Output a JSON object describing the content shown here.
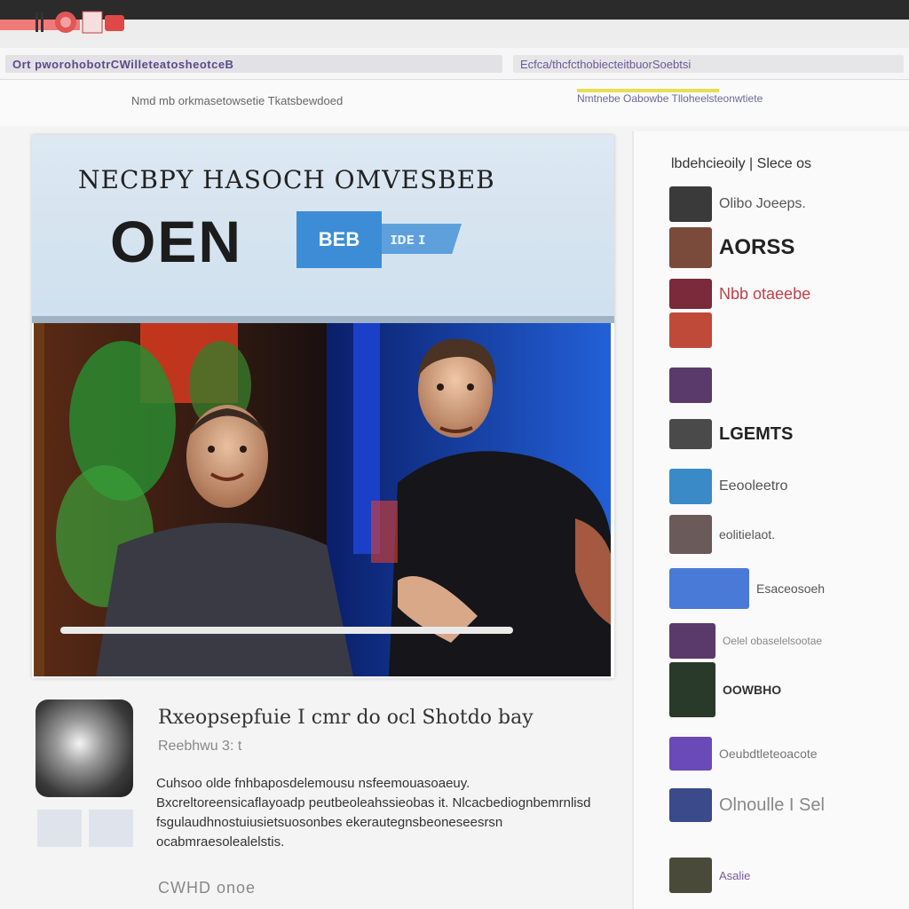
{
  "browser": {
    "url_left": "Ort pworohobotrCWilleteatosheotceB",
    "url_right": "Ecfca/thcfcthobiecteitbuorSoebtsi",
    "toolbar_text": "Nmd mb orkmasetowsetie Tkatsbewdoed",
    "toolbar_right": "Nmtnebe Oabowbe Tlloheelsteonwtiete"
  },
  "colors": {
    "accent_red": "#f07a7a",
    "badge_blue": "#3d8dd6"
  },
  "article": {
    "banner_top": "NECBPY  HASOCH  OMVESBEB",
    "banner_big": "OEN",
    "badge_text": "BEB",
    "badge_ext": "ɪᴅᴇ ɪ",
    "headline": "Rxeopsepfuie I cmr do ocl Shotdo bay",
    "subline": "Reebhwu 3: t",
    "paragraph": "Cuhsoo olde fnhbaposdelemousu nsfeemouasoaeuy. Bxcreltoreensicaflayoadp peutbeoleahssieobas it. Nlcacbediognbemrnlisd fsgulaudhnostuiusietsuosonbes ekerautegnsbeoneseesrsn ocabmraesolealelstis.",
    "footer": "CWHD onoe"
  },
  "sidebar": {
    "header": "lbdehcieoily | Slece os",
    "items": [
      {
        "label": "Olibo Joeeps.",
        "color": "#555",
        "weight": "normal",
        "size": 16
      },
      {
        "label": "AORSS",
        "color": "#222",
        "weight": "bold",
        "size": 24
      },
      {
        "label": "Nbb  otaeebe",
        "color": "#c0404a",
        "weight": "normal",
        "size": 18
      },
      {
        "label": "",
        "color": "#555",
        "weight": "normal",
        "size": 16
      },
      {
        "label": "",
        "color": "#555",
        "weight": "normal",
        "size": 16
      },
      {
        "label": "LGEMTS",
        "color": "#222",
        "weight": "bold",
        "size": 20
      },
      {
        "label": "Eeooleetro",
        "color": "#555",
        "weight": "normal",
        "size": 16
      },
      {
        "label": "eolitielaot.",
        "color": "#555",
        "weight": "normal",
        "size": 14
      },
      {
        "label": "Esaceosoeh",
        "color": "#555",
        "weight": "normal",
        "size": 14
      },
      {
        "label": "Oelel obaselelsootae",
        "color": "#888",
        "weight": "normal",
        "size": 12
      },
      {
        "label": "OOWBHO",
        "color": "#333",
        "weight": "bold",
        "size": 14
      },
      {
        "label": "Oeubdtleteoacote",
        "color": "#777",
        "weight": "normal",
        "size": 14
      },
      {
        "label": "Olnoulle I Sel",
        "color": "#888",
        "weight": "normal",
        "size": 20
      },
      {
        "label": "Asalie",
        "color": "#7a5a9a",
        "weight": "normal",
        "size": 13
      }
    ]
  }
}
